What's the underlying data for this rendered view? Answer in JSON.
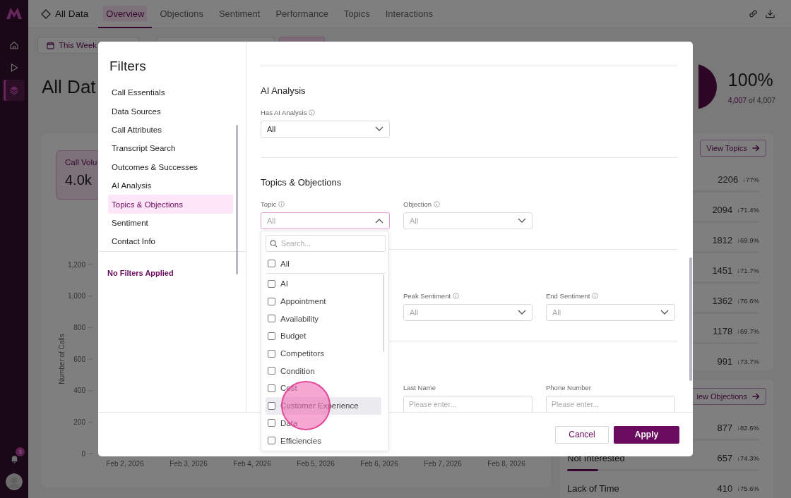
{
  "sidebar": {
    "items": [
      {
        "kind": "home",
        "selected": false
      },
      {
        "kind": "play",
        "selected": false
      },
      {
        "kind": "layers",
        "selected": true
      }
    ],
    "notification_count": "3"
  },
  "header": {
    "title": "All Data",
    "tabs": [
      {
        "label": "Overview",
        "selected": true
      },
      {
        "label": "Objections",
        "selected": false
      },
      {
        "label": "Sentiment",
        "selected": false
      },
      {
        "label": "Performance",
        "selected": false
      },
      {
        "label": "Topics",
        "selected": false
      },
      {
        "label": "Interactions",
        "selected": false
      }
    ]
  },
  "toolbar": {
    "date_range": "This Week"
  },
  "page_title": "All Dat",
  "coverage": {
    "percent": "100%",
    "count": "4,007",
    "total": "of 4,007"
  },
  "volume_card": {
    "label": "Call Volu",
    "value": "4.0k"
  },
  "chart": {
    "y_label": "Number of Calls",
    "y_ticks": [
      "1,200",
      "1,000",
      "800",
      "600",
      "400",
      "200",
      "0"
    ],
    "x_labels": [
      "Feb 2, 2026",
      "Feb 3, 2026",
      "Feb 4, 2026",
      "Feb 5, 2026",
      "Feb 6, 2026",
      "Feb 7, 2026",
      "Feb 8, 2026"
    ]
  },
  "topics": {
    "button": "View Topics",
    "rows": [
      {
        "count": "2206",
        "change": "↓77%"
      },
      {
        "count": "2094",
        "change": "↓71.4%"
      },
      {
        "count": "1812",
        "change": "↓69.9%"
      },
      {
        "count": "1451",
        "change": "↓71.7%"
      },
      {
        "count": "1362",
        "change": "↓76.6%"
      },
      {
        "count": "1178",
        "change": "↓69.7%"
      },
      {
        "count": "991",
        "change": "↓73.7%"
      }
    ]
  },
  "objections": {
    "button": "iew Objections",
    "rows": [
      {
        "count": "877",
        "change": "↓82.6%"
      },
      {
        "name": "Not Interested",
        "count": "657",
        "change": "↓74.3%",
        "level": 0.16
      },
      {
        "name": "Lack of Time",
        "count": "410",
        "change": "↓75.6%"
      }
    ]
  },
  "filters_modal": {
    "title": "Filters",
    "nav": [
      {
        "label": "Call Essentials",
        "selected": false
      },
      {
        "label": "Data Sources",
        "selected": false
      },
      {
        "label": "Call Attributes",
        "selected": false
      },
      {
        "label": "Transcript Search",
        "selected": false
      },
      {
        "label": "Outcomes & Successes",
        "selected": false
      },
      {
        "label": "AI Analysis",
        "selected": false
      },
      {
        "label": "Topics & Objections",
        "selected": true
      },
      {
        "label": "Sentiment",
        "selected": false
      },
      {
        "label": "Contact Info",
        "selected": false
      }
    ],
    "status": "No Filters Applied",
    "sections": [
      {
        "heading": "AI Analysis",
        "fields": [
          {
            "kind": "select",
            "label": "Has AI Analysis",
            "info": true,
            "value": "All",
            "open": false
          }
        ]
      },
      {
        "heading": "Topics & Objections",
        "fields": [
          {
            "kind": "select",
            "label": "Topic",
            "info": true,
            "placeholder": "All",
            "open": true
          },
          {
            "kind": "select",
            "label": "Objection",
            "info": true,
            "placeholder": "All",
            "open": false
          }
        ]
      },
      {
        "fields": [
          {
            "kind": "select",
            "label": "Peak Sentiment",
            "info": true,
            "placeholder": "All",
            "open": false
          },
          {
            "kind": "select",
            "label": "End Sentiment",
            "info": true,
            "placeholder": "All",
            "open": false
          }
        ]
      },
      {
        "fields": [
          {
            "kind": "input",
            "label": "Last Name",
            "info": false,
            "placeholder": "Please enter..."
          },
          {
            "kind": "input",
            "label": "Phone Number",
            "info": false,
            "placeholder": "Please enter..."
          }
        ]
      }
    ],
    "dropdown": {
      "search_placeholder": "Search...",
      "all": {
        "label": "All",
        "checked": false
      },
      "options": [
        {
          "label": "AI",
          "checked": false,
          "hovered": false
        },
        {
          "label": "Appointment",
          "checked": false,
          "hovered": false
        },
        {
          "label": "Availability",
          "checked": false,
          "hovered": false
        },
        {
          "label": "Budget",
          "checked": false,
          "hovered": false
        },
        {
          "label": "Competitors",
          "checked": false,
          "hovered": false
        },
        {
          "label": "Condition",
          "checked": false,
          "hovered": false
        },
        {
          "label": "Cost",
          "checked": false,
          "hovered": false
        },
        {
          "label": "Customer Experience",
          "checked": false,
          "hovered": true
        },
        {
          "label": "Data",
          "checked": false,
          "hovered": false
        },
        {
          "label": "Efficiencies",
          "checked": false,
          "hovered": false
        }
      ]
    },
    "buttons": {
      "cancel": "Cancel",
      "apply": "Apply"
    }
  }
}
